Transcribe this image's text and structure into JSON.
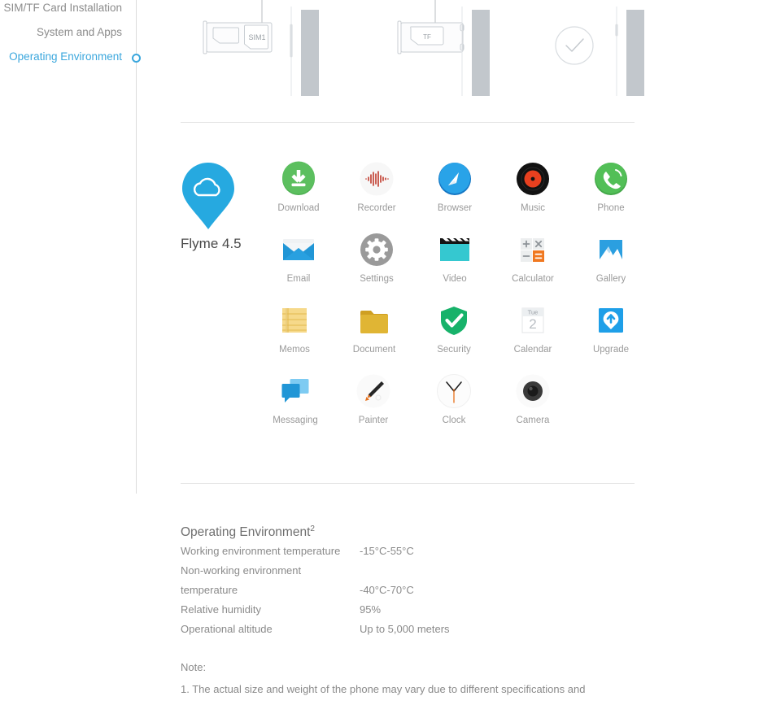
{
  "sidebar": {
    "items": [
      {
        "label": "SIM/TF Card Installation",
        "active": false
      },
      {
        "label": "System and Apps",
        "active": false
      },
      {
        "label": "Operating Environment",
        "active": true
      }
    ]
  },
  "sim_section": {
    "figures": [
      {
        "name": "sim1-tray",
        "card_label": "SIM1"
      },
      {
        "name": "tf-tray",
        "card_label": "TF"
      },
      {
        "name": "confirm-check",
        "card_label": ""
      }
    ]
  },
  "system": {
    "os_name": "Flyme 4.5",
    "os_icon": "flyme-cloud-pin-icon",
    "apps": [
      [
        {
          "label": "Download",
          "icon": "download-icon"
        },
        {
          "label": "Recorder",
          "icon": "recorder-icon"
        },
        {
          "label": "Browser",
          "icon": "browser-icon"
        },
        {
          "label": "Music",
          "icon": "music-icon"
        },
        {
          "label": "Phone",
          "icon": "phone-icon"
        }
      ],
      [
        {
          "label": "Email",
          "icon": "email-icon"
        },
        {
          "label": "Settings",
          "icon": "settings-icon"
        },
        {
          "label": "Video",
          "icon": "video-icon"
        },
        {
          "label": "Calculator",
          "icon": "calculator-icon"
        },
        {
          "label": "Gallery",
          "icon": "gallery-icon"
        }
      ],
      [
        {
          "label": "Memos",
          "icon": "memos-icon"
        },
        {
          "label": "Document",
          "icon": "document-icon"
        },
        {
          "label": "Security",
          "icon": "security-icon"
        },
        {
          "label": "Calendar",
          "icon": "calendar-icon"
        },
        {
          "label": "Upgrade",
          "icon": "upgrade-icon"
        }
      ],
      [
        {
          "label": "Messaging",
          "icon": "messaging-icon"
        },
        {
          "label": "Painter",
          "icon": "painter-icon"
        },
        {
          "label": "Clock",
          "icon": "clock-icon"
        },
        {
          "label": "Camera",
          "icon": "camera-icon"
        }
      ]
    ],
    "calendar_icon": {
      "weekday": "Tue",
      "day": "2"
    },
    "calculator_icon": {
      "plus": "+",
      "times": "×",
      "minus": "−",
      "equals": "="
    }
  },
  "operating_environment": {
    "title": "Operating Environment",
    "title_superscript": "2",
    "rows": [
      {
        "key": "Working environment temperature",
        "value": "-15°C-55°C"
      },
      {
        "key": "Non-working environment",
        "value": ""
      },
      {
        "key": "temperature",
        "value": "-40°C-70°C"
      },
      {
        "key": "Relative humidity",
        "value": "95%"
      },
      {
        "key": "Operational altitude",
        "value": "Up to 5,000 meters"
      }
    ]
  },
  "notes": {
    "heading": "Note:",
    "items": [
      "1. The actual size and weight of the phone may vary due to different specifications and"
    ]
  },
  "colors": {
    "accent_blue": "#3ba7dd",
    "flyme_blue": "#26a9e0",
    "download_green": "#4caf50",
    "recorder_red": "#c62828",
    "browser_blue": "#1a8fd8",
    "music_black": "#1a1a1a",
    "music_red": "#e8401f",
    "phone_green": "#4cb050",
    "email_blue": "#2196d6",
    "settings_gray": "#9a9a9a",
    "video_cyan": "#35c8d0",
    "calculator_orange": "#f07820",
    "gallery_blue": "#2b9fe0",
    "memos_yellow": "#f2cf6a",
    "document_gold": "#dcad2c",
    "security_green": "#17b26a",
    "upgrade_blue": "#1e9fe8",
    "messaging_blue": "#2196d6",
    "painter_orange": "#e8701a",
    "camera_dark": "#3a3a3a",
    "text_gray": "#8a8a8a",
    "divider": "#e4e4e4"
  }
}
